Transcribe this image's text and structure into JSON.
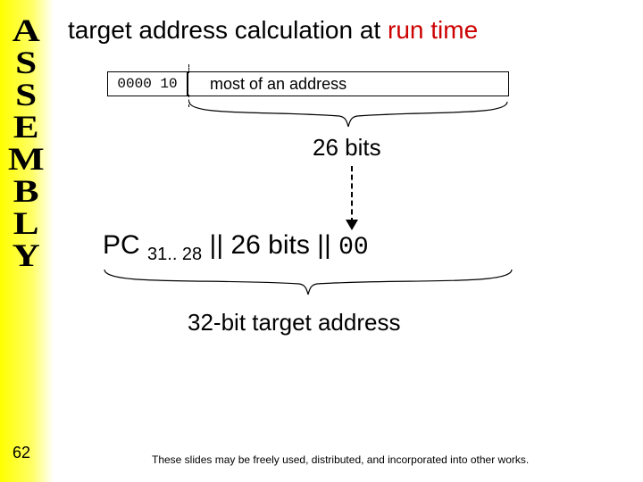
{
  "sidebar_label": "ASSEMBLY",
  "title_prefix": "target address calculation ",
  "title_at": "at ",
  "title_runtime": "run time",
  "opcode": "0000 10",
  "addr_label": "most of an address",
  "bits26": "26 bits",
  "expr_pc": "PC ",
  "expr_sub": "31.. 28",
  "expr_mid": "  ||  26 bits  ||  ",
  "expr_suffix": "00",
  "target32": "32-bit target address",
  "slide_num": "62",
  "footer": "These slides may be freely used, distributed, and incorporated into other works."
}
